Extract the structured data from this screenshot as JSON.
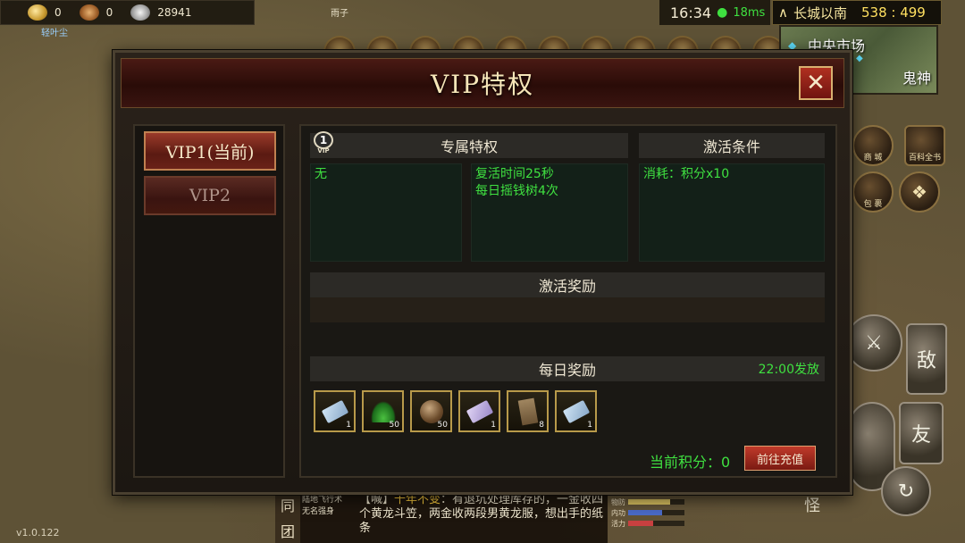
{
  "hud": {
    "gold": "0",
    "coupons": "0",
    "silver": "28941",
    "player_name": "轻叶尘",
    "npc_name": "雨子",
    "time": "16:34",
    "ping": "18ms",
    "location": "长城以南",
    "coords": "538 : 499",
    "minimap_label1": "中央市场",
    "minimap_label2": "鬼神",
    "shop_label": "商 城",
    "bag_label": "包 裹",
    "encyclopedia_label": "百科全书",
    "enemy_button": "敌",
    "friend_button": "友",
    "monster_label": "怪",
    "version": "v1.0.122"
  },
  "chat": {
    "channel_top": "同",
    "channel_bottom": "团",
    "names_line1": "陆地飞行术",
    "names_line2": "无名强身",
    "message_tag": "【喊】",
    "message_speaker": "千年不变",
    "message_text": "：有退坑处理库存的，一金收四个黄龙斗笠，两金收两段男黄龙服，想出手的纸条"
  },
  "stats": {
    "row1": "物防",
    "row2": "内功",
    "row3": "活力",
    "row1_fill": 0.75,
    "row2_fill": 0.6,
    "row3_fill": 0.45
  },
  "vip_dialog": {
    "title": "VIP特权",
    "close": "✕",
    "tabs": [
      {
        "label": "VIP1(当前)",
        "active": true
      },
      {
        "label": "VIP2",
        "active": false
      }
    ],
    "badge_number": "1",
    "badge_label": "VIP",
    "exclusive_header": "专属特权",
    "activation_header": "激活条件",
    "privilege_none": "无",
    "privilege_line1": "复活时间25秒",
    "privilege_line2": "每日摇钱树4次",
    "activation_cost": "消耗：积分x10",
    "activation_reward_header": "激活奖励",
    "daily_reward_header": "每日奖励",
    "release_time": "22:00发放",
    "daily_items": [
      {
        "icon": "paper-ticket-icon",
        "qty": "1"
      },
      {
        "icon": "herb-grass-icon",
        "qty": "50"
      },
      {
        "icon": "drum-icon",
        "qty": "50"
      },
      {
        "icon": "purple-ticket-icon",
        "qty": "1"
      },
      {
        "icon": "wooden-board-icon",
        "qty": "8"
      },
      {
        "icon": "paper-ticket-icon",
        "qty": "1"
      }
    ],
    "current_points": "当前积分：0",
    "recharge_button": "前往充值"
  },
  "colors": {
    "accent_green": "#3fe040",
    "title_gold": "#f6e6b8",
    "active_tab": "#9a3a2a"
  }
}
